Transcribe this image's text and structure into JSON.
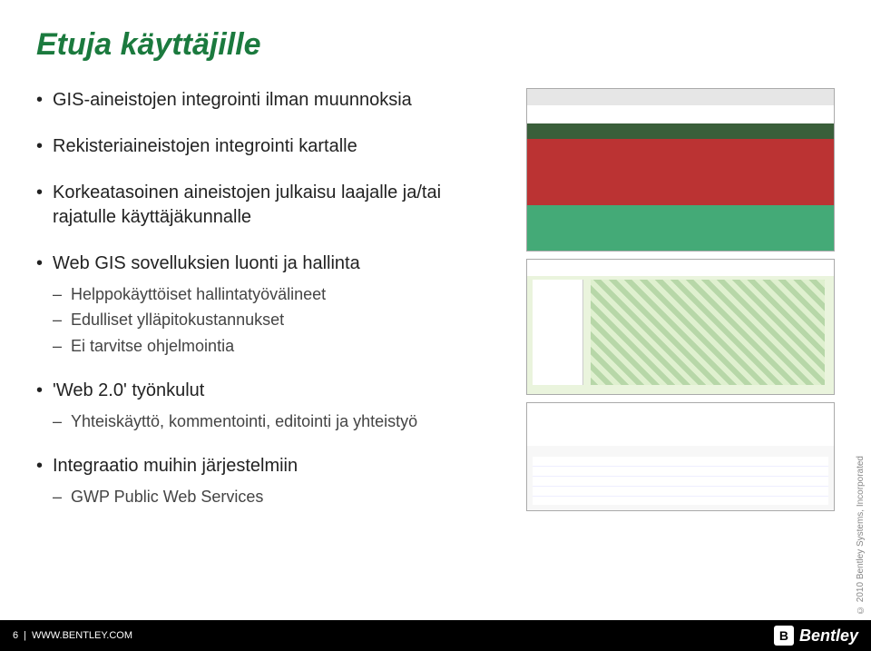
{
  "title": "Etuja käyttäjille",
  "bullets": {
    "b1": "GIS-aineistojen integrointi ilman muunnoksia",
    "b2": "Rekisteriaineistojen integrointi kartalle",
    "b3": "Korkeatasoinen aineistojen julkaisu laajalle ja/tai rajatulle käyttäjäkunnalle",
    "b4": "Web GIS sovelluksien luonti ja hallinta",
    "b4_sub": {
      "s1": "Helppokäyttöiset hallintatyövälineet",
      "s2": "Edulliset ylläpitokustannukset",
      "s3": "Ei tarvitse ohjelmointia"
    },
    "b5": "'Web 2.0' työnkulut",
    "b5_sub": {
      "s1": "Yhteiskäyttö, kommentointi, editointi ja yhteistyö"
    },
    "b6": "Integraatio muihin järjestelmiin",
    "b6_sub": {
      "s1": "GWP Public Web Services"
    }
  },
  "footer": {
    "page": "6",
    "sep": "|",
    "url": "WWW.BENTLEY.COM",
    "brand": "Bentley",
    "logo_mark": "B"
  },
  "copyright": "© 2010 Bentley Systems, Incorporated"
}
